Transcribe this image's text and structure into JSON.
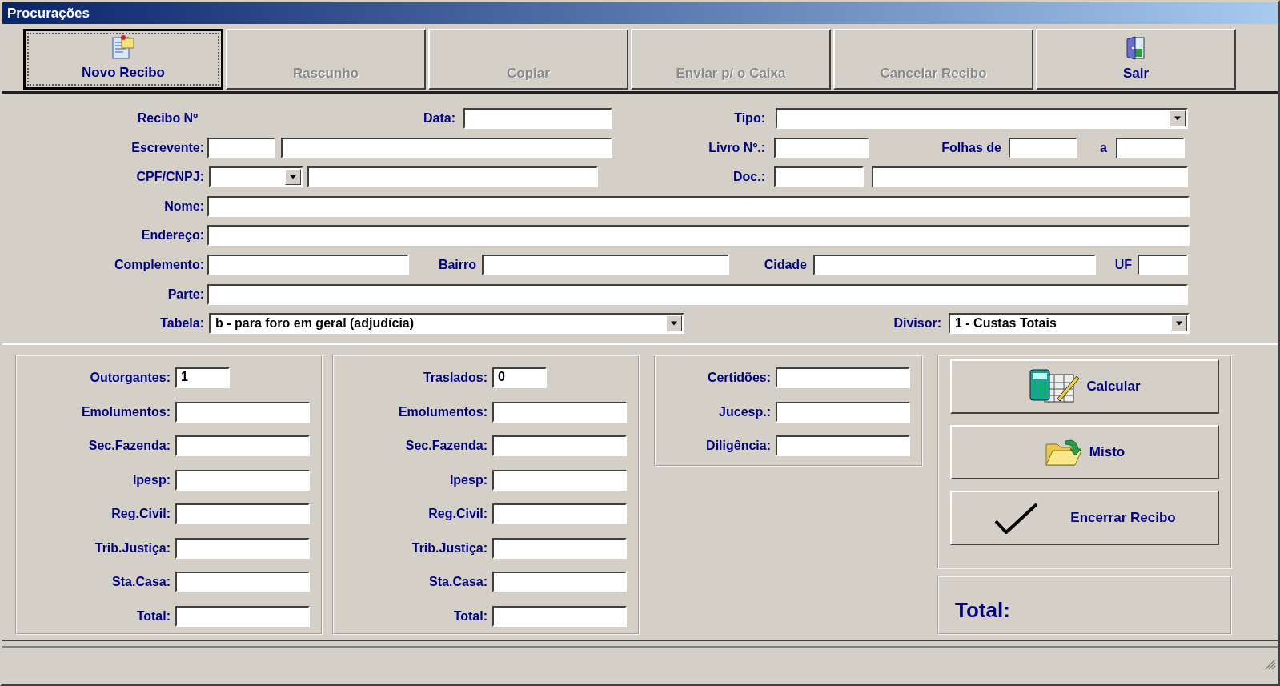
{
  "window": {
    "title": "Procurações"
  },
  "toolbar": [
    {
      "label": "Novo Recibo",
      "kind": "document",
      "disabled": false,
      "focused": true
    },
    {
      "label": "Rascunho",
      "disabled": true,
      "focused": false
    },
    {
      "label": "Copiar",
      "disabled": true,
      "focused": false
    },
    {
      "label": "Enviar p/ o Caixa",
      "disabled": true,
      "focused": false
    },
    {
      "label": "Cancelar Recibo",
      "disabled": true,
      "focused": false
    },
    {
      "label": "Sair",
      "kind": "door",
      "disabled": false,
      "focused": false
    }
  ],
  "form_rows": [
    {
      "items": [
        {
          "kind": "label",
          "text": "Recibo Nº"
        },
        {
          "kind": "label",
          "text": "Data:"
        },
        {
          "kind": "field"
        },
        {
          "kind": "label",
          "text": "Tipo:"
        },
        {
          "kind": "combo"
        }
      ]
    },
    {
      "items": [
        {
          "kind": "label",
          "text": "Escrevente:"
        },
        {
          "kind": "field"
        },
        {
          "kind": "field"
        },
        {
          "kind": "label",
          "text": "Livro Nº.:"
        },
        {
          "kind": "field"
        },
        {
          "kind": "label",
          "text": "Folhas de"
        },
        {
          "kind": "field"
        },
        {
          "kind": "label",
          "text": "a"
        },
        {
          "kind": "field"
        }
      ]
    },
    {
      "items": [
        {
          "kind": "label",
          "text": "CPF/CNPJ:"
        },
        {
          "kind": "combo"
        },
        {
          "kind": "field"
        },
        {
          "kind": "label",
          "text": "Doc.:"
        },
        {
          "kind": "field"
        },
        {
          "kind": "field"
        }
      ]
    },
    {
      "items": [
        {
          "kind": "label",
          "text": "Nome:"
        },
        {
          "kind": "field"
        }
      ]
    },
    {
      "items": [
        {
          "kind": "label",
          "text": "Endereço:"
        },
        {
          "kind": "field"
        }
      ]
    },
    {
      "items": [
        {
          "kind": "label",
          "text": "Complemento:"
        },
        {
          "kind": "field"
        },
        {
          "kind": "label",
          "text": "Bairro"
        },
        {
          "kind": "field"
        },
        {
          "kind": "label",
          "text": "Cidade"
        },
        {
          "kind": "field"
        },
        {
          "kind": "label",
          "text": "UF"
        },
        {
          "kind": "field"
        }
      ]
    },
    {
      "items": [
        {
          "kind": "label",
          "text": "Parte:"
        },
        {
          "kind": "field"
        }
      ]
    },
    {
      "items": [
        {
          "kind": "label",
          "text": "Tabela:"
        },
        {
          "kind": "combo",
          "value": "b - para foro em geral (adjudícia)"
        },
        {
          "kind": "label",
          "text": "Divisor:"
        },
        {
          "kind": "combo",
          "value": "1 - Custas Totais"
        }
      ]
    }
  ],
  "panels": [
    {
      "rows": [
        {
          "label": "Outorgantes:",
          "value": "1"
        },
        {
          "label": "Emolumentos:"
        },
        {
          "label": "Sec.Fazenda:"
        },
        {
          "label": "Ipesp:"
        },
        {
          "label": "Reg.Civil:"
        },
        {
          "label": "Trib.Justiça:"
        },
        {
          "label": "Sta.Casa:"
        },
        {
          "label": "Total:"
        }
      ]
    },
    {
      "rows": [
        {
          "label": "Traslados:",
          "value": "0"
        },
        {
          "label": "Emolumentos:"
        },
        {
          "label": "Sec.Fazenda:"
        },
        {
          "label": "Ipesp:"
        },
        {
          "label": "Reg.Civil:"
        },
        {
          "label": "Trib.Justiça:"
        },
        {
          "label": "Sta.Casa:"
        },
        {
          "label": "Total:"
        }
      ]
    },
    {
      "rows": [
        {
          "label": "Certidões:"
        },
        {
          "label": "Jucesp.:"
        },
        {
          "label": "Diligência:"
        }
      ]
    }
  ],
  "actions": [
    {
      "label": "Calcular",
      "kind": "calculator"
    },
    {
      "label": "Misto",
      "kind": "folder"
    },
    {
      "label": "Encerrar Recibo",
      "kind": "check"
    }
  ],
  "total": {
    "label": "Total:"
  }
}
